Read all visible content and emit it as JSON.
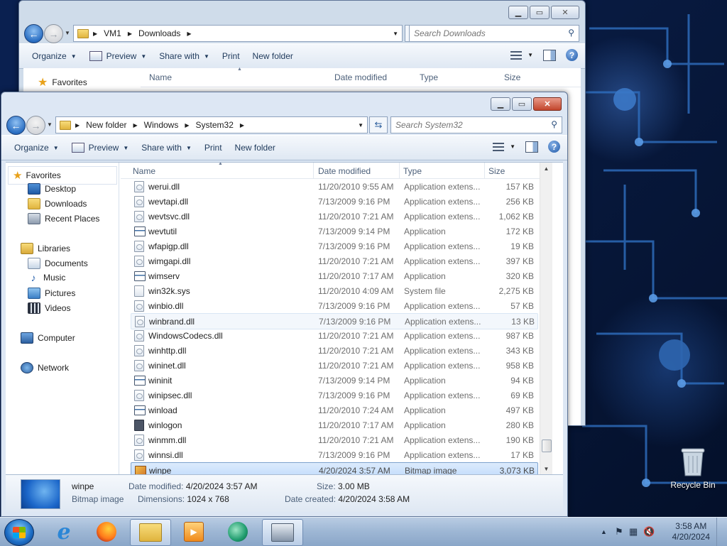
{
  "desktop": {
    "recycle_bin_label": "Recycle Bin"
  },
  "back_window": {
    "breadcrumbs": [
      "VM1",
      "Downloads"
    ],
    "search_placeholder": "Search Downloads",
    "toolbar": {
      "organize": "Organize",
      "preview": "Preview",
      "share_with": "Share with",
      "print": "Print",
      "new_folder": "New folder"
    },
    "nav_favorites": "Favorites",
    "columns": [
      "Name",
      "Date modified",
      "Type",
      "Size"
    ]
  },
  "front_window": {
    "breadcrumbs": [
      "New folder",
      "Windows",
      "System32"
    ],
    "search_placeholder": "Search System32",
    "toolbar": {
      "organize": "Organize",
      "preview": "Preview",
      "share_with": "Share with",
      "print": "Print",
      "new_folder": "New folder"
    },
    "nav": {
      "favorites": "Favorites",
      "desktop": "Desktop",
      "downloads": "Downloads",
      "recent_places": "Recent Places",
      "libraries": "Libraries",
      "documents": "Documents",
      "music": "Music",
      "pictures": "Pictures",
      "videos": "Videos",
      "computer": "Computer",
      "network": "Network"
    },
    "columns": {
      "name": "Name",
      "date_modified": "Date modified",
      "type": "Type",
      "size": "Size"
    },
    "files": [
      {
        "name": "werui.dll",
        "date": "11/20/2010 9:55 AM",
        "type": "Application extens...",
        "size": "157 KB",
        "icon": "dll"
      },
      {
        "name": "wevtapi.dll",
        "date": "7/13/2009 9:16 PM",
        "type": "Application extens...",
        "size": "256 KB",
        "icon": "dll"
      },
      {
        "name": "wevtsvc.dll",
        "date": "11/20/2010 7:21 AM",
        "type": "Application extens...",
        "size": "1,062 KB",
        "icon": "dll"
      },
      {
        "name": "wevtutil",
        "date": "7/13/2009 9:14 PM",
        "type": "Application",
        "size": "172 KB",
        "icon": "app"
      },
      {
        "name": "wfapigp.dll",
        "date": "7/13/2009 9:16 PM",
        "type": "Application extens...",
        "size": "19 KB",
        "icon": "dll"
      },
      {
        "name": "wimgapi.dll",
        "date": "11/20/2010 7:21 AM",
        "type": "Application extens...",
        "size": "397 KB",
        "icon": "dll"
      },
      {
        "name": "wimserv",
        "date": "11/20/2010 7:17 AM",
        "type": "Application",
        "size": "320 KB",
        "icon": "app"
      },
      {
        "name": "win32k.sys",
        "date": "11/20/2010 4:09 AM",
        "type": "System file",
        "size": "2,275 KB",
        "icon": "sys"
      },
      {
        "name": "winbio.dll",
        "date": "7/13/2009 9:16 PM",
        "type": "Application extens...",
        "size": "57 KB",
        "icon": "dll"
      },
      {
        "name": "winbrand.dll",
        "date": "7/13/2009 9:16 PM",
        "type": "Application extens...",
        "size": "13 KB",
        "icon": "dll"
      },
      {
        "name": "WindowsCodecs.dll",
        "date": "11/20/2010 7:21 AM",
        "type": "Application extens...",
        "size": "987 KB",
        "icon": "dll"
      },
      {
        "name": "winhttp.dll",
        "date": "11/20/2010 7:21 AM",
        "type": "Application extens...",
        "size": "343 KB",
        "icon": "dll"
      },
      {
        "name": "wininet.dll",
        "date": "11/20/2010 7:21 AM",
        "type": "Application extens...",
        "size": "958 KB",
        "icon": "dll"
      },
      {
        "name": "wininit",
        "date": "7/13/2009 9:14 PM",
        "type": "Application",
        "size": "94 KB",
        "icon": "app"
      },
      {
        "name": "winipsec.dll",
        "date": "7/13/2009 9:16 PM",
        "type": "Application extens...",
        "size": "69 KB",
        "icon": "dll"
      },
      {
        "name": "winload",
        "date": "11/20/2010 7:24 AM",
        "type": "Application",
        "size": "497 KB",
        "icon": "app"
      },
      {
        "name": "winlogon",
        "date": "11/20/2010 7:17 AM",
        "type": "Application",
        "size": "280 KB",
        "icon": "logon"
      },
      {
        "name": "winmm.dll",
        "date": "11/20/2010 7:21 AM",
        "type": "Application extens...",
        "size": "190 KB",
        "icon": "dll"
      },
      {
        "name": "winnsi.dll",
        "date": "7/13/2009 9:16 PM",
        "type": "Application extens...",
        "size": "17 KB",
        "icon": "dll"
      },
      {
        "name": "winpe",
        "date": "4/20/2024 3:57 AM",
        "type": "Bitmap image",
        "size": "3,073 KB",
        "icon": "bmp"
      }
    ],
    "hovered_index": 9,
    "selected_index": 19,
    "details": {
      "name": "winpe",
      "type": "Bitmap image",
      "date_modified_label": "Date modified:",
      "date_modified": "4/20/2024 3:57 AM",
      "size_label": "Size:",
      "size": "3.00 MB",
      "dimensions_label": "Dimensions:",
      "dimensions": "1024 x 768",
      "date_created_label": "Date created:",
      "date_created": "4/20/2024 3:58 AM"
    }
  },
  "taskbar": {
    "time": "3:58 AM",
    "date": "4/20/2024",
    "apps": [
      "internet-explorer",
      "firefox",
      "windows-explorer",
      "media-player",
      "app-green",
      "network-app"
    ]
  }
}
